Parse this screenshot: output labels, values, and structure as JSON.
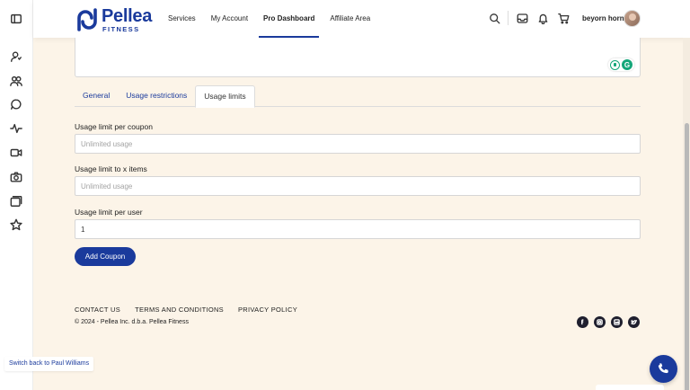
{
  "rail": {
    "items": [
      "sidebar-toggle",
      "user-profile",
      "users-group",
      "chat",
      "activity",
      "video",
      "camera",
      "gallery",
      "star"
    ]
  },
  "header": {
    "logo_name": "Pellea",
    "logo_sub": "FITNESS",
    "nav": [
      {
        "label": "Services",
        "active": false
      },
      {
        "label": "My Account",
        "active": false
      },
      {
        "label": "Pro Dashboard",
        "active": true
      },
      {
        "label": "Affiliate Area",
        "active": false
      }
    ],
    "user_name": "beyorn horn"
  },
  "tabs": [
    {
      "label": "General",
      "active": false
    },
    {
      "label": "Usage restrictions",
      "active": false
    },
    {
      "label": "Usage limits",
      "active": true
    }
  ],
  "form": {
    "per_coupon_label": "Usage limit per coupon",
    "per_coupon_placeholder": "Unlimited usage",
    "per_coupon_value": "",
    "x_items_label": "Usage limit to x items",
    "x_items_placeholder": "Unlimited usage",
    "x_items_value": "",
    "per_user_label": "Usage limit per user",
    "per_user_placeholder": "",
    "per_user_value": "1",
    "submit_label": "Add Coupon"
  },
  "footer": {
    "links": [
      "CONTACT US",
      "TERMS AND CONDITIONS",
      "PRIVACY POLICY"
    ],
    "copyright": "© 2024 - Pellea Inc. d.b.a. Pellea Fitness",
    "socials": [
      "facebook",
      "instagram",
      "linkedin",
      "twitter"
    ]
  },
  "switch_back": "Switch back to Paul Williams",
  "colors": {
    "brand": "#1a3a9c",
    "background": "#fcf4e8",
    "grammarly": "#15a679"
  }
}
